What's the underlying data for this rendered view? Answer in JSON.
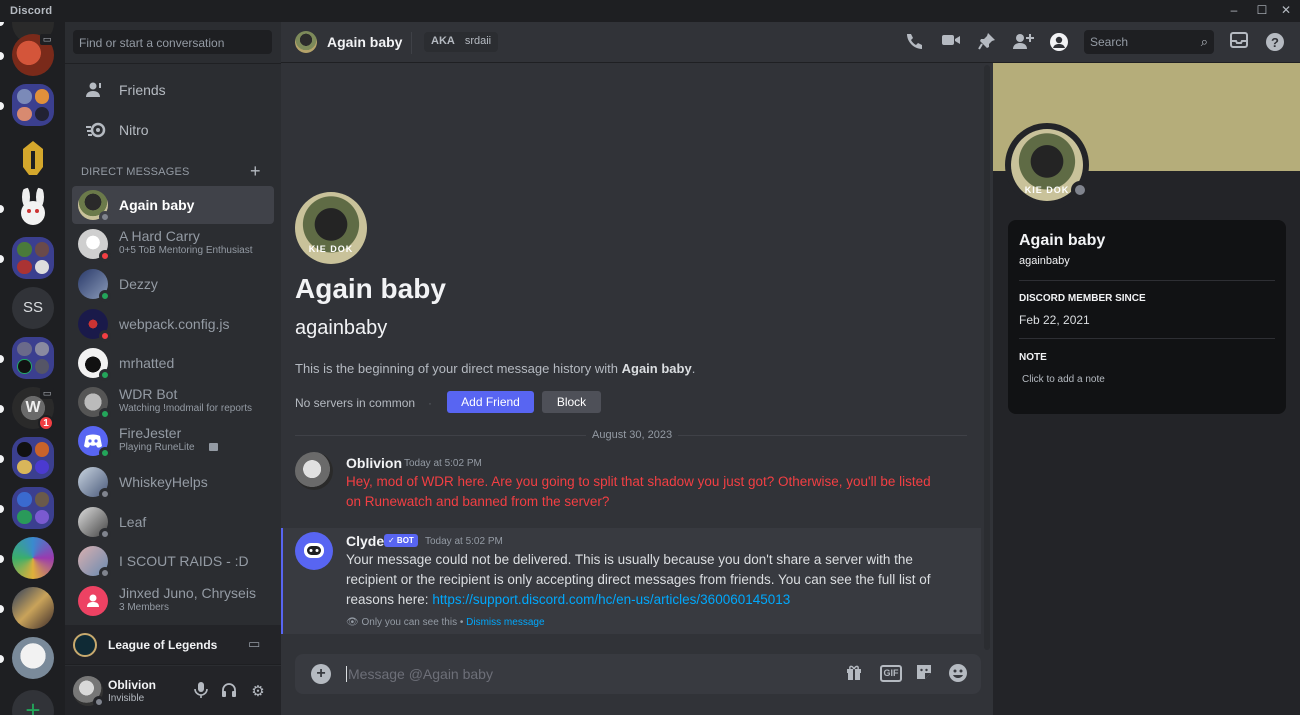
{
  "app": {
    "title": "Discord"
  },
  "window_controls": [
    "–",
    "☐",
    "✕"
  ],
  "rail": {
    "servers": [
      {
        "name": "server-1",
        "unread": true
      },
      {
        "name": "server-2",
        "unread": true
      },
      {
        "name": "server-folder-1",
        "unread": true
      },
      {
        "name": "server-helmet",
        "unread": false
      },
      {
        "name": "server-bunny",
        "unread": true
      },
      {
        "name": "server-folder-2",
        "unread": true
      },
      {
        "name": "server-ss",
        "initials": "SS",
        "unread": false
      },
      {
        "name": "server-folder-3",
        "unread": true
      },
      {
        "name": "server-wdr",
        "unread": true,
        "mentions": "1"
      },
      {
        "name": "server-folder-4",
        "unread": true
      },
      {
        "name": "server-folder-5",
        "unread": true
      },
      {
        "name": "server-colorful",
        "unread": true
      },
      {
        "name": "server-art",
        "unread": true
      },
      {
        "name": "server-bird",
        "unread": true
      }
    ],
    "add_label": "+"
  },
  "dm_sidebar": {
    "search_placeholder": "Find or start a conversation",
    "nav": [
      {
        "label": "Friends",
        "icon": "friends-icon"
      },
      {
        "label": "Nitro",
        "icon": "nitro-icon"
      }
    ],
    "section_header": "DIRECT MESSAGES",
    "add_dm_label": "+",
    "dms": [
      {
        "name": "Again baby",
        "sub": "",
        "status": "offline",
        "selected": true,
        "avatar_color": "#6b7a4a"
      },
      {
        "name": "A Hard Carry",
        "sub": "0+5 ToB Mentoring Enthusiast",
        "status": "dnd",
        "selected": false,
        "avatar_color": "#d8d8d8"
      },
      {
        "name": "Dezzy",
        "sub": "",
        "status": "online",
        "selected": false,
        "avatar_color": "#5a6c8a"
      },
      {
        "name": "webpack.config.js",
        "sub": "",
        "status": "dnd",
        "selected": false,
        "avatar_color": "#2a2a6a"
      },
      {
        "name": "mrhatted",
        "sub": "",
        "status": "online",
        "selected": false,
        "avatar_color": "#f2f2f2"
      },
      {
        "name": "WDR Bot",
        "sub": "Watching !modmail for reports",
        "status": "online",
        "selected": false,
        "avatar_color": "#9a9a9a"
      },
      {
        "name": "FireJester",
        "sub": "Playing RuneLite",
        "status": "online",
        "selected": false,
        "avatar_color": "#5865f2"
      },
      {
        "name": "WhiskeyHelps",
        "sub": "",
        "status": "offline",
        "selected": false,
        "avatar_color": "#7a8aa0"
      },
      {
        "name": "Leaf",
        "sub": "",
        "status": "offline",
        "selected": false,
        "avatar_color": "#8a8a8a"
      },
      {
        "name": "I SCOUT RAIDS - :D",
        "sub": "",
        "status": "offline",
        "selected": false,
        "avatar_color": "#b08a8a"
      },
      {
        "name": "Jinxed Juno, Chryseis",
        "sub": "3 Members",
        "status": "",
        "selected": false,
        "avatar_color": "#ed4263"
      }
    ],
    "activity": {
      "label": "League of Legends"
    },
    "user": {
      "name": "Oblivion",
      "status": "Invisible"
    }
  },
  "header": {
    "name": "Again baby",
    "aka_label": "AKA",
    "aka_value": "srdaii",
    "icons": [
      "call-icon",
      "video-icon",
      "pin-icon",
      "add-member-icon",
      "user-profile-icon"
    ],
    "search_placeholder": "Search"
  },
  "chat": {
    "profile_name": "Again baby",
    "profile_username": "againbaby",
    "avatar_caption": "KIE DOK",
    "intro_prefix": "This is the beginning of your direct message history with ",
    "intro_name": "Again baby",
    "intro_suffix": ".",
    "no_common": "No servers in common",
    "add_friend": "Add Friend",
    "block": "Block",
    "date_divider": "August 30, 2023",
    "messages": [
      {
        "author": "Oblivion",
        "time": "Today at 5:02 PM",
        "text": "Hey, mod of WDR here. Are you going to split that shadow you just got? Otherwise, you'll be listed on Runewatch and banned from the server?"
      },
      {
        "author": "Clyde",
        "badge": "✓ BOT",
        "time": "Today at 5:02 PM",
        "text": "Your message could not be delivered. This is usually because you don't share a server with the recipient or the recipient is only accepting direct messages from friends. You can see the full list of reasons here: ",
        "link": "https://support.discord.com/hc/en-us/articles/360060145013",
        "note": "Only you can see this",
        "dismiss": "Dismiss message"
      }
    ],
    "composer_placeholder": "Message @Again baby",
    "gif_label": "GIF"
  },
  "profile_panel": {
    "banner_color": "#b5ad7a",
    "name": "Again baby",
    "username": "againbaby",
    "member_since_label": "DISCORD MEMBER SINCE",
    "member_since": "Feb 22, 2021",
    "note_label": "NOTE",
    "note_placeholder": "Click to add a note"
  },
  "colors": {
    "accent": "#5865f2",
    "online": "#23a55a",
    "dnd": "#f23f43",
    "offline": "#80848e",
    "link": "#00a8fc"
  }
}
